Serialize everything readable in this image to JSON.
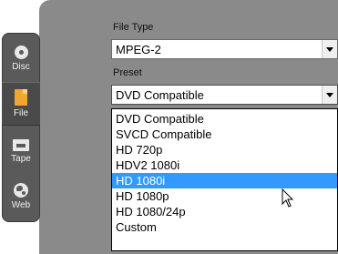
{
  "sidebar": {
    "tabs": [
      {
        "label": "Disc",
        "icon": "disc-icon"
      },
      {
        "label": "File",
        "icon": "file-icon"
      },
      {
        "label": "Tape",
        "icon": "tape-icon"
      },
      {
        "label": "Web",
        "icon": "web-icon"
      }
    ],
    "active_tab": "File"
  },
  "file_type": {
    "label": "File Type",
    "value": "MPEG-2"
  },
  "preset": {
    "label": "Preset",
    "value": "DVD Compatible",
    "options": [
      "DVD Compatible",
      "SVCD Compatible",
      "HD 720p",
      "HDV2 1080i",
      "HD 1080i",
      "HD 1080p",
      "HD 1080/24p",
      "Custom"
    ],
    "highlighted_option": "HD 1080i"
  },
  "colors": {
    "panel_bg": "#8a8a8a",
    "tabstrip_bg": "#5a5a5a",
    "highlight": "#3399ff",
    "file_icon": "#f0a630"
  }
}
